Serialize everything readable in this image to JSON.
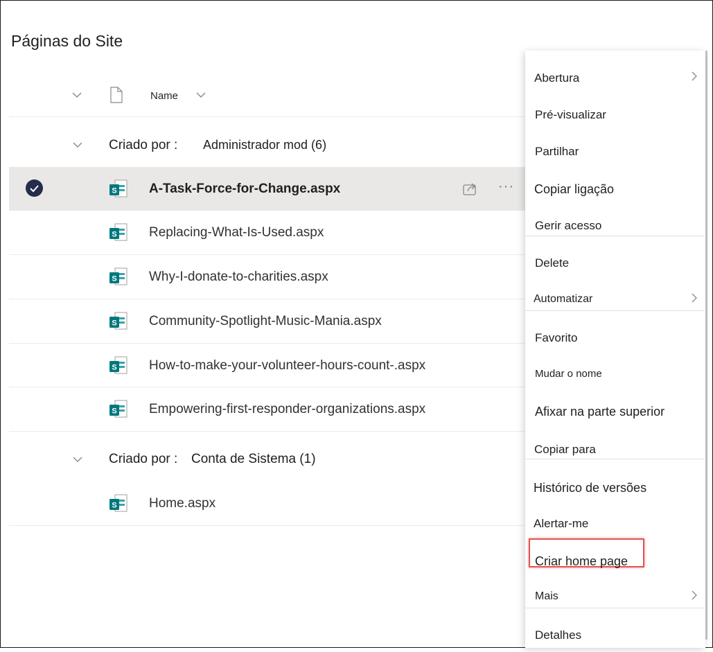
{
  "page": {
    "title": "Páginas do Site"
  },
  "list_header": {
    "name_column": "Name"
  },
  "groups": [
    {
      "label": "Criado por :",
      "value": "Administrador mod (6)"
    },
    {
      "label": "Criado por :",
      "value": "Conta de Sistema (1)"
    }
  ],
  "files": [
    "A-Task-Force-for-Change.aspx",
    "Replacing-What-Is-Used.aspx",
    "Why-I-donate-to-charities.aspx",
    "Community-Spotlight-Music-Mania.aspx",
    "How-to-make-your-volunteer-hours-count-.aspx",
    "Empowering-first-responder-organizations.aspx",
    "Home.aspx"
  ],
  "row_actions": {
    "more": "···"
  },
  "context_menu": {
    "items": [
      "Abertura",
      "Pré-visualizar",
      "Partilhar",
      "Copiar ligação",
      "Gerir acesso",
      "Delete",
      "Automatizar",
      "Favorito",
      "Mudar o nome",
      "Afixar na parte superior",
      "Copiar para",
      "Histórico de versões",
      "Alertar-me",
      "Criar home page",
      "Mais",
      "Detalhes"
    ],
    "highlighted_item": "Criar home page"
  },
  "colors": {
    "sharepoint_icon": "#03787c",
    "selected_row": "#e9e8e7",
    "check_circle": "#252c4c",
    "highlight_border": "#e2534f"
  },
  "icons": {
    "header_file": "document-icon",
    "row_file": "sharepoint-page-icon",
    "share": "share-icon",
    "submenu": "chevron-right-icon"
  }
}
